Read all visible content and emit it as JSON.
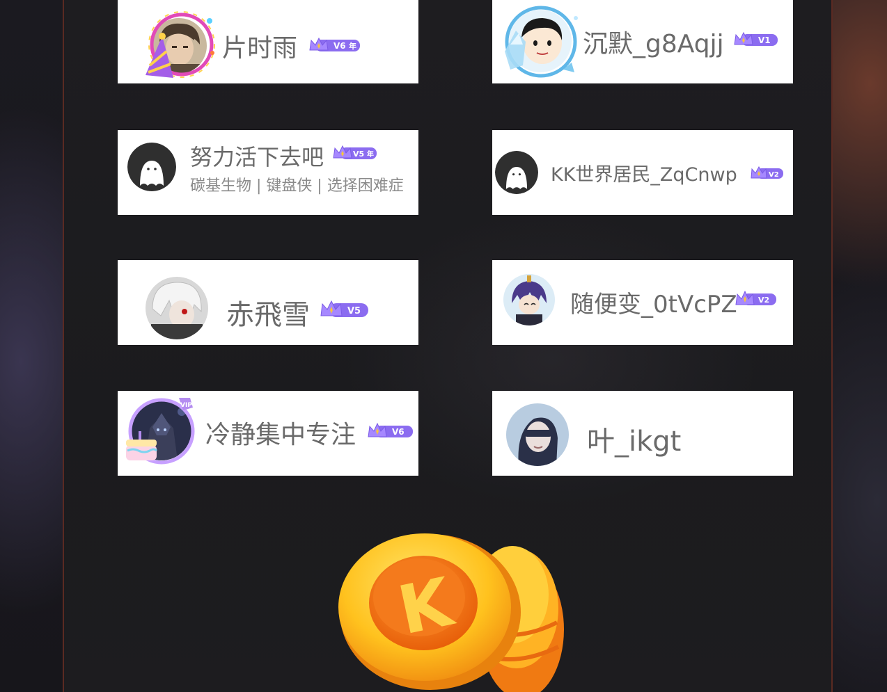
{
  "users": [
    {
      "name": "片时雨",
      "vip": "V6",
      "year_badge": "年",
      "avatar": "anime-boy-avatar",
      "frame": "party-hat-frame"
    },
    {
      "name": "沉默_g8Aqjj",
      "vip": "V1",
      "avatar": "cartoon-boy-avatar",
      "frame": "ice-frame"
    },
    {
      "name": "努力活下去吧",
      "vip": "V5",
      "year_badge": "年",
      "bio": "碳基生物 | 键盘侠 | 选择困难症",
      "avatar": "default-ghost-avatar"
    },
    {
      "name": "KK世界居民_ZqCnwp",
      "vip": "V2",
      "avatar": "default-ghost-avatar"
    },
    {
      "name": "赤飛雪",
      "vip": "V5",
      "avatar": "white-hair-anime-avatar"
    },
    {
      "name": "随便变_0tVcPZ",
      "vip": "V2",
      "avatar": "chibi-character-avatar"
    },
    {
      "name": "冷静集中专注",
      "vip": "V6",
      "avatar": "dark-knight-avatar",
      "frame": "vip-cake-frame"
    },
    {
      "name": "叶_ikgt",
      "avatar": "blindfold-anime-avatar"
    }
  ],
  "coin_icon": "k-coin-stack-icon",
  "coin_letter": "K",
  "colors": {
    "vip_purple": "#8b6cf0",
    "crown_gold": "#f6c343",
    "card_bg": "#ffffff",
    "name_text": "#6a6a6a",
    "coin_orange": "#f58a1f"
  }
}
